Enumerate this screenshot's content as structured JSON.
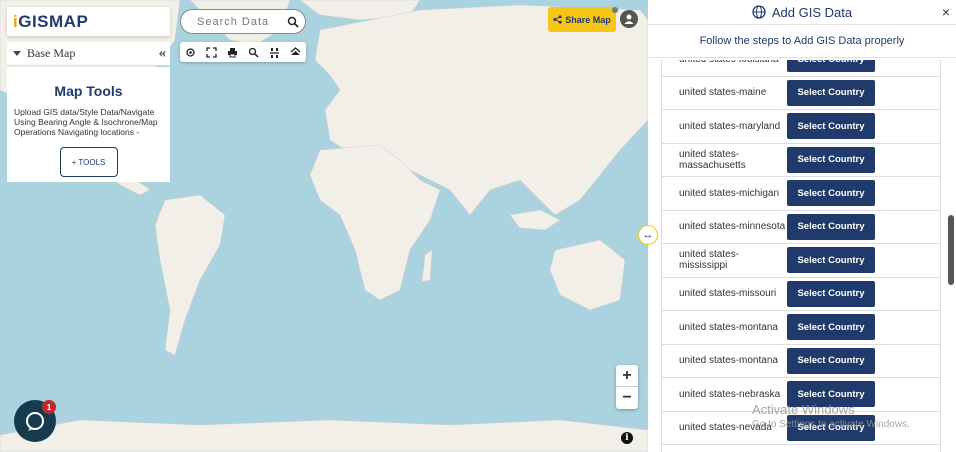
{
  "logo": {
    "prefix": "i",
    "text": "GISMAP"
  },
  "search": {
    "placeholder": "Search Data"
  },
  "basemap": {
    "label": "Base Map",
    "collapse": "«"
  },
  "tools": {
    "title": "Map Tools",
    "description": "Upload GIS data/Style Data/Navigate Using Bearing Angle & Isochrone/Map Operations Navigating locations -",
    "button": "+ TOOLS"
  },
  "share": {
    "label": "Share Map"
  },
  "zoom": {
    "in": "+",
    "out": "−"
  },
  "info": {
    "label": "i"
  },
  "chat": {
    "badge": "1"
  },
  "resize": {
    "label": "↔"
  },
  "panel": {
    "title": "Add GIS Data",
    "close": "×",
    "subtitle": "Follow the steps to Add GIS Data properly",
    "button_label": "Select Country",
    "rows": [
      {
        "name": "united states-louisiana"
      },
      {
        "name": "united states-maine"
      },
      {
        "name": "united states-maryland"
      },
      {
        "name": "united states-massachusetts"
      },
      {
        "name": "united states-michigan"
      },
      {
        "name": "united states-minnesota"
      },
      {
        "name": "united states-mississippi"
      },
      {
        "name": "united states-missouri"
      },
      {
        "name": "united states-montana"
      },
      {
        "name": "united states-montana"
      },
      {
        "name": "united states-nebraska"
      },
      {
        "name": "united states-nevada"
      }
    ]
  },
  "watermark": {
    "line1": "Activate Windows",
    "line2": "Go to Settings to activate Windows."
  }
}
